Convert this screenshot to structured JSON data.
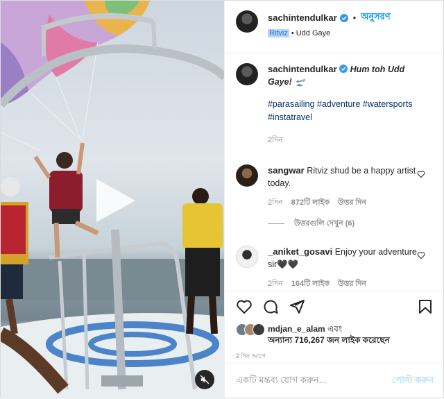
{
  "header": {
    "username": "sachintendulkar",
    "follow_label": "অনুসরণ",
    "dot": "•",
    "tagged_user": "Ritviz",
    "audio_title": "Udd Gaye"
  },
  "caption": {
    "username": "sachintendulkar",
    "text": "Hum toh Udd Gaye! 🛫",
    "hashtags": "#parasailing #adventure #watersports #instatravel",
    "time": "2দিন"
  },
  "comments": [
    {
      "username": "sangwar",
      "text": "Ritviz shud be a happy artist today.",
      "time": "2দিন",
      "likes": "872টি লাইক",
      "reply_label": "উত্তর দিন",
      "view_replies": "উত্তরগুলি দেখুন (6)"
    },
    {
      "username": "_aniket_gosavi",
      "text": "Enjoy your adventure sir🖤🖤",
      "time": "2দিন",
      "likes": "164টি লাইক",
      "reply_label": "উত্তর দিন"
    }
  ],
  "likes": {
    "first_user": "mdjan_e_alam",
    "and_word": "এবং",
    "rest": "অন্যান্য 716,267 জন লাইক করেছেন"
  },
  "post_time": "2 দিন আগে",
  "add_comment": {
    "placeholder": "একটি মন্তব্য যোগ করুন...",
    "post_label": "পোস্ট করুন"
  },
  "icons": {
    "like": "heart-icon",
    "comment": "comment-icon",
    "share": "share-icon",
    "save": "bookmark-icon",
    "play": "play-icon",
    "mute": "muted-speaker-icon",
    "verified": "verified-badge-icon"
  },
  "colors": {
    "link": "#0095f6",
    "hashtag": "#00376b",
    "muted": "#8e8e8e",
    "text": "#262626",
    "verified": "#3897f0"
  }
}
